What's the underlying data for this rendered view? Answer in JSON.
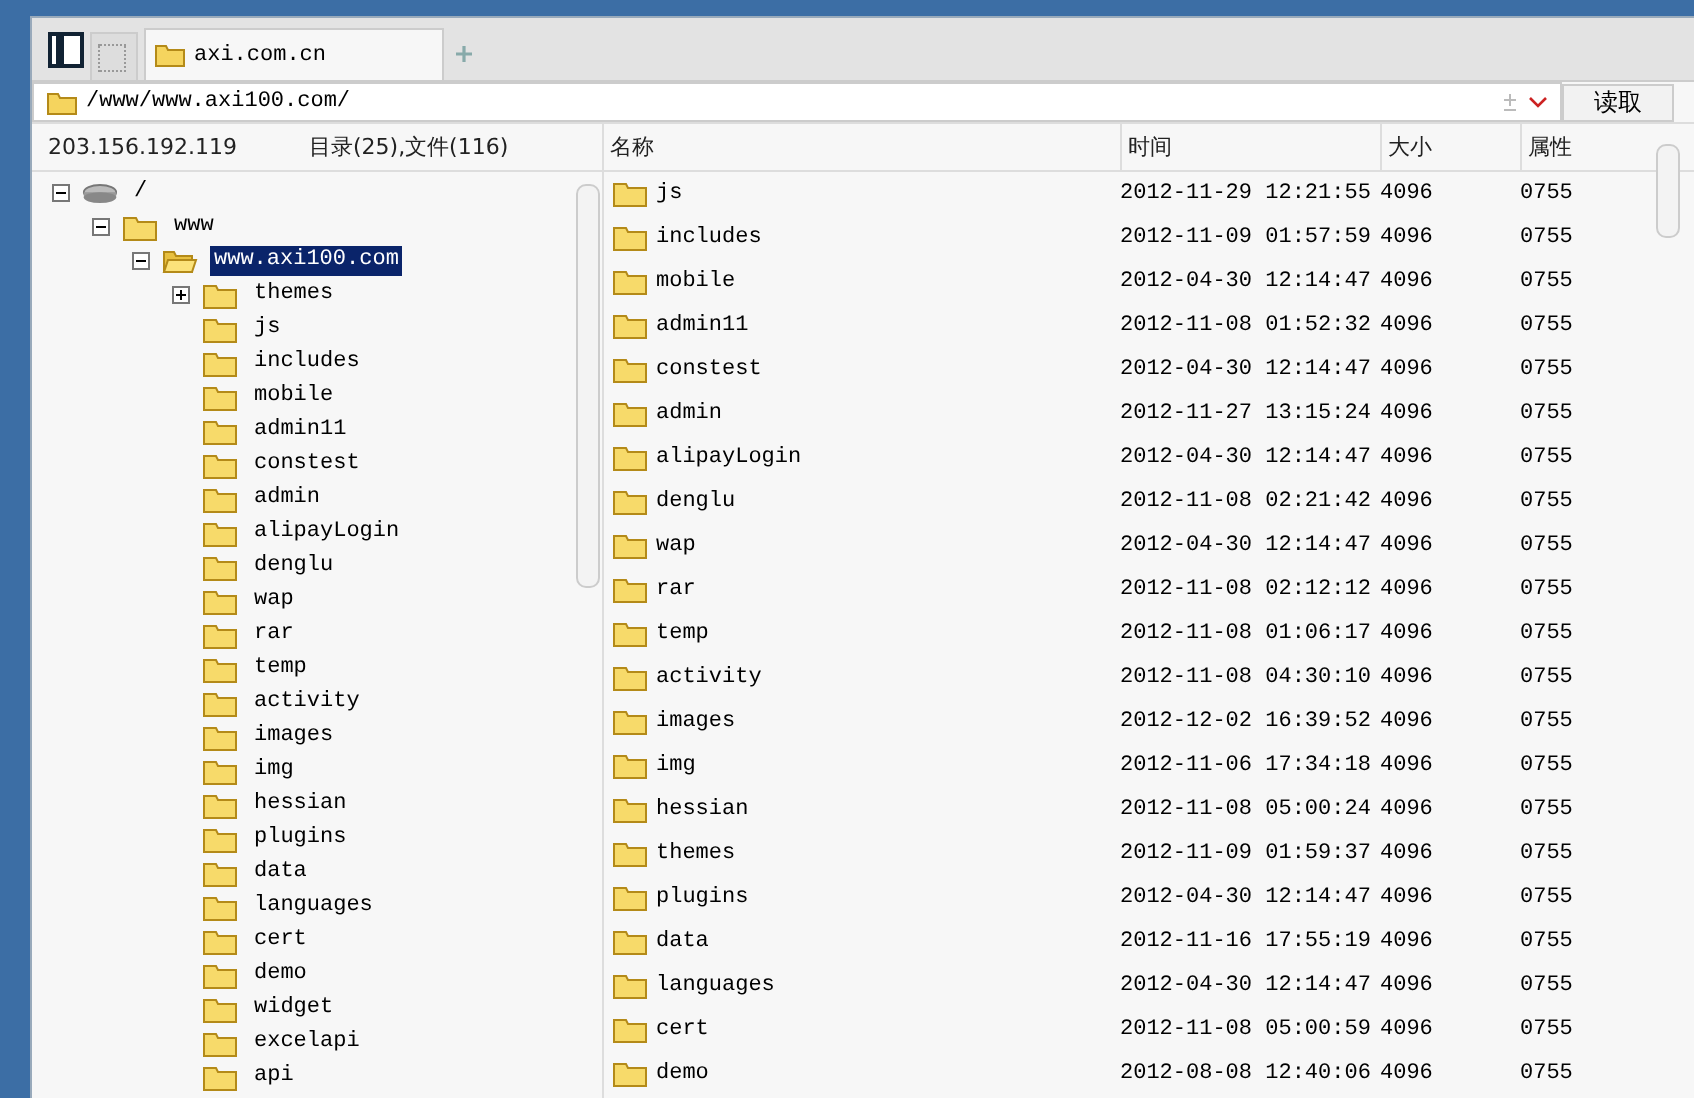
{
  "tabs": [
    {
      "label": "axi.com.cn",
      "selected": true
    }
  ],
  "address": {
    "value": "/www/www.axi100.com/",
    "button": "读取"
  },
  "status": {
    "host": "203.156.192.119",
    "counts": "目录(25),文件(116)"
  },
  "tree": [
    {
      "label": "/",
      "kind": "drive",
      "expandable": true,
      "expanded": true,
      "selected": false,
      "children": [
        {
          "label": "www",
          "kind": "folder",
          "expandable": true,
          "expanded": true,
          "selected": false,
          "children": [
            {
              "label": "www.axi100.com",
              "kind": "folder-open",
              "expandable": true,
              "expanded": true,
              "selected": true,
              "children": [
                {
                  "label": "themes",
                  "kind": "folder",
                  "expandable": true,
                  "expanded": false,
                  "selected": false
                },
                {
                  "label": "js",
                  "kind": "folder",
                  "expandable": false,
                  "selected": false
                },
                {
                  "label": "includes",
                  "kind": "folder",
                  "expandable": false,
                  "selected": false
                },
                {
                  "label": "mobile",
                  "kind": "folder",
                  "expandable": false,
                  "selected": false
                },
                {
                  "label": "admin11",
                  "kind": "folder",
                  "expandable": false,
                  "selected": false
                },
                {
                  "label": "constest",
                  "kind": "folder",
                  "expandable": false,
                  "selected": false
                },
                {
                  "label": "admin",
                  "kind": "folder",
                  "expandable": false,
                  "selected": false
                },
                {
                  "label": "alipayLogin",
                  "kind": "folder",
                  "expandable": false,
                  "selected": false
                },
                {
                  "label": "denglu",
                  "kind": "folder",
                  "expandable": false,
                  "selected": false
                },
                {
                  "label": "wap",
                  "kind": "folder",
                  "expandable": false,
                  "selected": false
                },
                {
                  "label": "rar",
                  "kind": "folder",
                  "expandable": false,
                  "selected": false
                },
                {
                  "label": "temp",
                  "kind": "folder",
                  "expandable": false,
                  "selected": false
                },
                {
                  "label": "activity",
                  "kind": "folder",
                  "expandable": false,
                  "selected": false
                },
                {
                  "label": "images",
                  "kind": "folder",
                  "expandable": false,
                  "selected": false
                },
                {
                  "label": "img",
                  "kind": "folder",
                  "expandable": false,
                  "selected": false
                },
                {
                  "label": "hessian",
                  "kind": "folder",
                  "expandable": false,
                  "selected": false
                },
                {
                  "label": "plugins",
                  "kind": "folder",
                  "expandable": false,
                  "selected": false
                },
                {
                  "label": "data",
                  "kind": "folder",
                  "expandable": false,
                  "selected": false
                },
                {
                  "label": "languages",
                  "kind": "folder",
                  "expandable": false,
                  "selected": false
                },
                {
                  "label": "cert",
                  "kind": "folder",
                  "expandable": false,
                  "selected": false
                },
                {
                  "label": "demo",
                  "kind": "folder",
                  "expandable": false,
                  "selected": false
                },
                {
                  "label": "widget",
                  "kind": "folder",
                  "expandable": false,
                  "selected": false
                },
                {
                  "label": "excelapi",
                  "kind": "folder",
                  "expandable": false,
                  "selected": false
                },
                {
                  "label": "api",
                  "kind": "folder",
                  "expandable": false,
                  "selected": false
                }
              ]
            }
          ]
        }
      ]
    }
  ],
  "table": {
    "columns": [
      "名称",
      "时间",
      "大小",
      "属性"
    ],
    "rows": [
      [
        "js",
        "2012-11-29 12:21:55",
        "4096",
        "0755"
      ],
      [
        "includes",
        "2012-11-09 01:57:59",
        "4096",
        "0755"
      ],
      [
        "mobile",
        "2012-04-30 12:14:47",
        "4096",
        "0755"
      ],
      [
        "admin11",
        "2012-11-08 01:52:32",
        "4096",
        "0755"
      ],
      [
        "constest",
        "2012-04-30 12:14:47",
        "4096",
        "0755"
      ],
      [
        "admin",
        "2012-11-27 13:15:24",
        "4096",
        "0755"
      ],
      [
        "alipayLogin",
        "2012-04-30 12:14:47",
        "4096",
        "0755"
      ],
      [
        "denglu",
        "2012-11-08 02:21:42",
        "4096",
        "0755"
      ],
      [
        "wap",
        "2012-04-30 12:14:47",
        "4096",
        "0755"
      ],
      [
        "rar",
        "2012-11-08 02:12:12",
        "4096",
        "0755"
      ],
      [
        "temp",
        "2012-11-08 01:06:17",
        "4096",
        "0755"
      ],
      [
        "activity",
        "2012-11-08 04:30:10",
        "4096",
        "0755"
      ],
      [
        "images",
        "2012-12-02 16:39:52",
        "4096",
        "0755"
      ],
      [
        "img",
        "2012-11-06 17:34:18",
        "4096",
        "0755"
      ],
      [
        "hessian",
        "2012-11-08 05:00:24",
        "4096",
        "0755"
      ],
      [
        "themes",
        "2012-11-09 01:59:37",
        "4096",
        "0755"
      ],
      [
        "plugins",
        "2012-04-30 12:14:47",
        "4096",
        "0755"
      ],
      [
        "data",
        "2012-11-16 17:55:19",
        "4096",
        "0755"
      ],
      [
        "languages",
        "2012-04-30 12:14:47",
        "4096",
        "0755"
      ],
      [
        "cert",
        "2012-11-08 05:00:59",
        "4096",
        "0755"
      ],
      [
        "demo",
        "2012-08-08 12:40:06",
        "4096",
        "0755"
      ]
    ]
  }
}
